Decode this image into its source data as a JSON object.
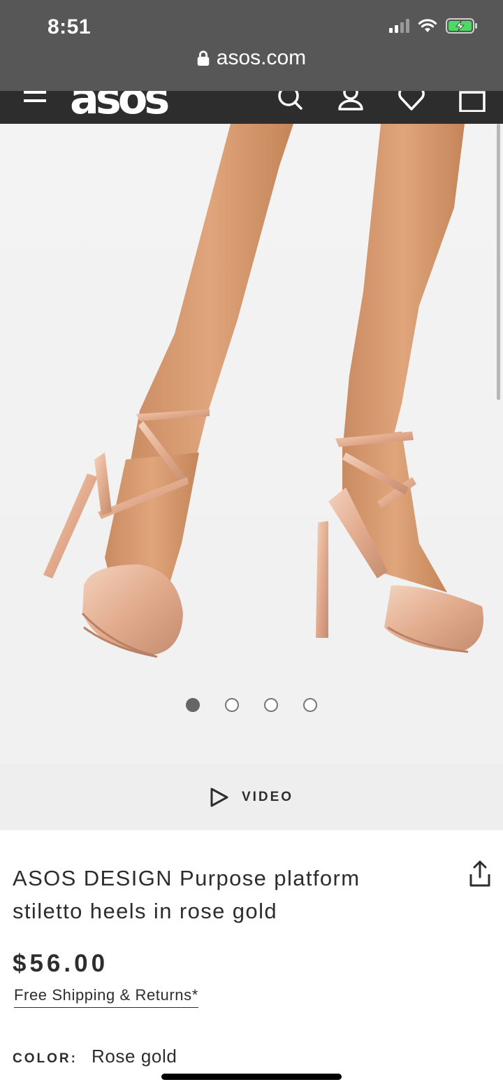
{
  "status_bar": {
    "time": "8:51"
  },
  "browser": {
    "url": "asos.com"
  },
  "header": {
    "logo": "asos"
  },
  "gallery": {
    "slide_count": 4,
    "active_slide": 1
  },
  "video": {
    "label": "VIDEO"
  },
  "product": {
    "title": "ASOS DESIGN Purpose platform stiletto heels in rose gold",
    "price": "$56.00",
    "shipping_link": "Free Shipping & Returns*",
    "color_label": "COLOR:",
    "color_value": "Rose gold"
  },
  "colors": {
    "header_bg": "#2d2d2d",
    "safari_bg": "#575757",
    "battery_green": "#4cd964",
    "shoe_rose_gold": "#e6b79b"
  },
  "icons": [
    "lock-icon",
    "hamburger-icon",
    "search-icon",
    "account-icon",
    "wishlist-heart-icon",
    "bag-icon",
    "play-icon",
    "share-icon",
    "wifi-icon",
    "battery-icon",
    "signal-icon"
  ]
}
